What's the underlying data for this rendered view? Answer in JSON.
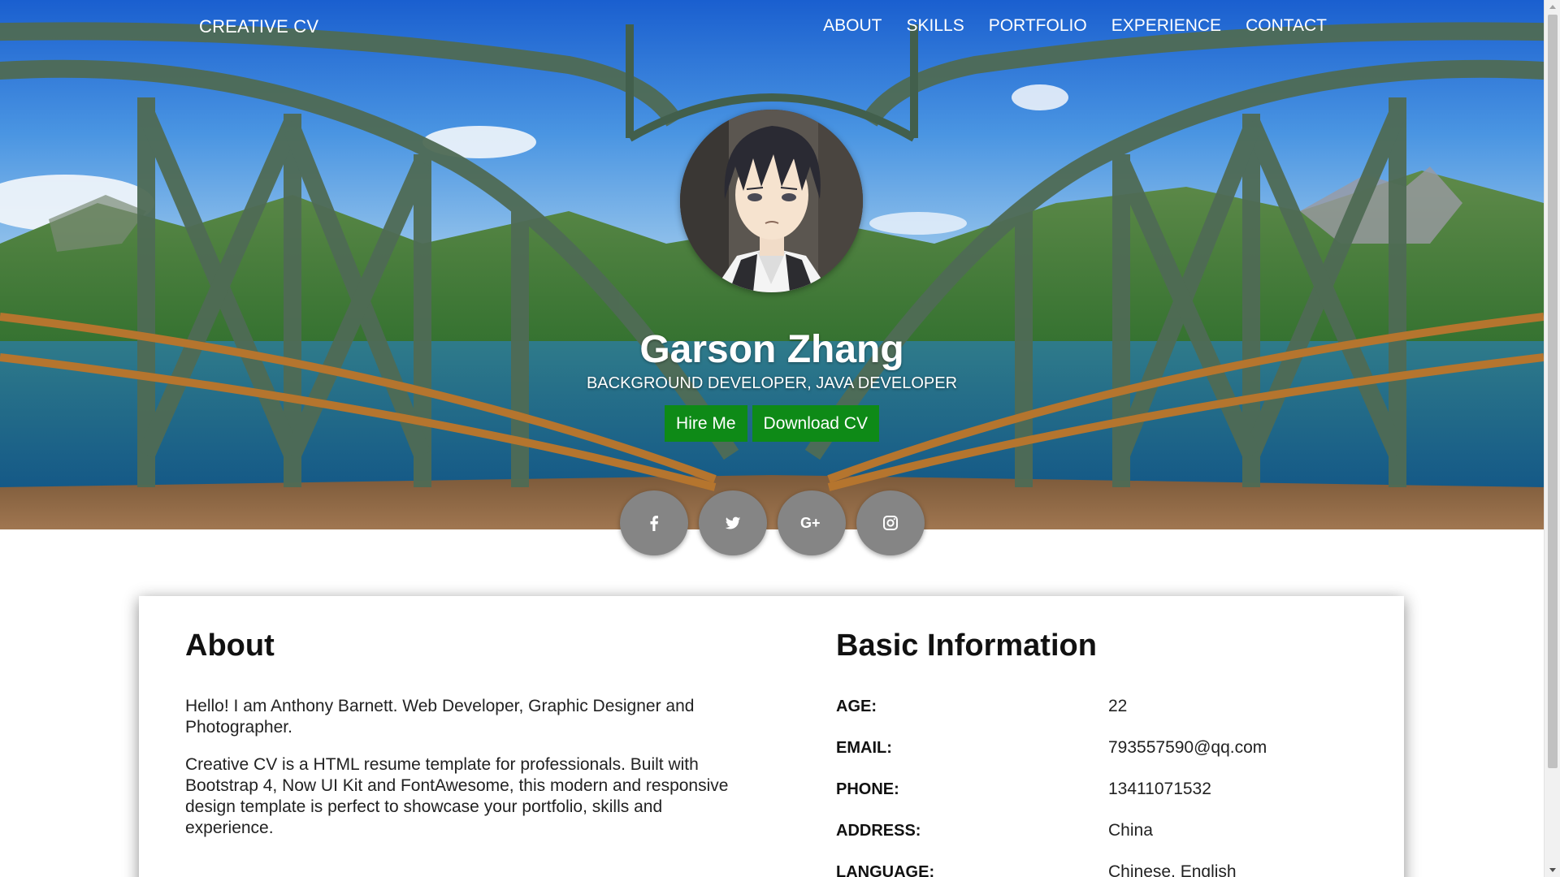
{
  "nav": {
    "brand": "CREATIVE CV",
    "links": [
      "ABOUT",
      "SKILLS",
      "PORTFOLIO",
      "EXPERIENCE",
      "CONTACT"
    ]
  },
  "profile": {
    "name": "Garson Zhang",
    "subtitle": "BACKGROUND DEVELOPER, JAVA DEVELOPER",
    "hire_label": "Hire Me",
    "download_label": "Download CV"
  },
  "social": {
    "icons": [
      "facebook-icon",
      "twitter-icon",
      "google-plus-icon",
      "instagram-icon"
    ],
    "glyphs": [
      "f",
      "",
      "G+",
      ""
    ]
  },
  "about": {
    "heading": "About",
    "paragraphs": [
      "Hello! I am Anthony Barnett. Web Developer, Graphic Designer and Photographer.",
      "Creative CV is a HTML resume template for professionals. Built with Bootstrap 4, Now UI Kit and FontAwesome, this modern and responsive design template is perfect to showcase your portfolio, skills and experience."
    ]
  },
  "basic_info": {
    "heading": "Basic Information",
    "rows": [
      {
        "label": "AGE:",
        "value": "22"
      },
      {
        "label": "EMAIL:",
        "value": "793557590@qq.com"
      },
      {
        "label": "PHONE:",
        "value": "13411071532"
      },
      {
        "label": "ADDRESS:",
        "value": "China"
      },
      {
        "label": "LANGUAGE:",
        "value": "Chinese, English"
      }
    ]
  },
  "colors": {
    "button_green": "#0e8a17",
    "social_gray": "#858585",
    "text_dark": "#111111"
  }
}
